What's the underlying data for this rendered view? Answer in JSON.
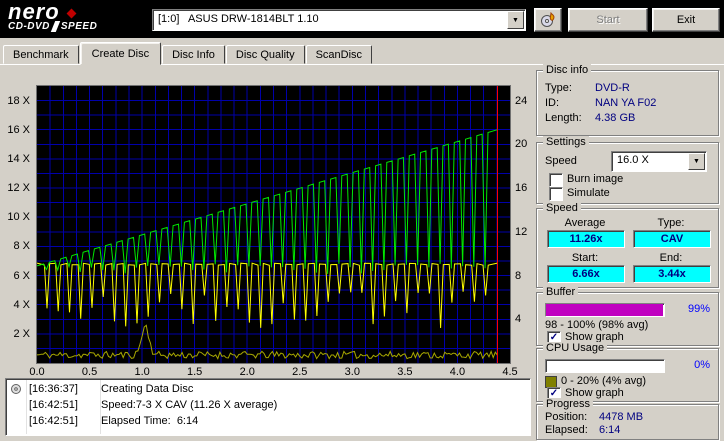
{
  "brand": {
    "name": "nero",
    "product_left": "CD-DVD",
    "product_right": "SPEED"
  },
  "icons": {
    "dropdown_arrow": "▼",
    "checkmark": "✓"
  },
  "toolbar": {
    "drive_select_value": "[1:0]   ASUS DRW-1814BLT 1.10",
    "start_label": "Start",
    "exit_label": "Exit"
  },
  "tabs": [
    {
      "label": "Benchmark",
      "active": false
    },
    {
      "label": "Create Disc",
      "active": true
    },
    {
      "label": "Disc Info",
      "active": false
    },
    {
      "label": "Disc Quality",
      "active": false
    },
    {
      "label": "ScanDisc",
      "active": false
    }
  ],
  "chart_data": {
    "type": "line",
    "title": "",
    "background": "#000000",
    "grid": {
      "color": "#0000aa",
      "x_step": 0.125,
      "y_step": 1
    },
    "x_range": [
      0,
      4.5
    ],
    "x_ticks": [
      {
        "v": 0,
        "label": "0.0"
      },
      {
        "v": 0.5,
        "label": "0.5"
      },
      {
        "v": 1,
        "label": "1.0"
      },
      {
        "v": 1.5,
        "label": "1.5"
      },
      {
        "v": 2,
        "label": "2.0"
      },
      {
        "v": 2.5,
        "label": "2.5"
      },
      {
        "v": 3,
        "label": "3.0"
      },
      {
        "v": 3.5,
        "label": "3.5"
      },
      {
        "v": 4,
        "label": "4.0"
      },
      {
        "v": 4.5,
        "label": "4.5"
      }
    ],
    "left_axis": {
      "range": [
        0,
        19
      ],
      "ticks": [
        {
          "v": 18,
          "label": "18 X"
        },
        {
          "v": 16,
          "label": "16 X"
        },
        {
          "v": 14,
          "label": "14 X"
        },
        {
          "v": 12,
          "label": "12 X"
        },
        {
          "v": 10,
          "label": "10 X"
        },
        {
          "v": 8,
          "label": "8 X"
        },
        {
          "v": 6,
          "label": "6 X"
        },
        {
          "v": 4,
          "label": "4 X"
        },
        {
          "v": 2,
          "label": "2 X"
        }
      ]
    },
    "right_axis": {
      "range": [
        0,
        25.33
      ],
      "ticks": [
        {
          "v": 24,
          "label": "24"
        },
        {
          "v": 20,
          "label": "20"
        },
        {
          "v": 16,
          "label": "16"
        },
        {
          "v": 12,
          "label": "12"
        },
        {
          "v": 8,
          "label": "8"
        },
        {
          "v": 4,
          "label": "4"
        }
      ]
    },
    "disc_end_marker": {
      "x": 4.38,
      "color": "#ff0000"
    },
    "series": [
      {
        "name": "cpu-usage",
        "color": "#a8a800",
        "shape": "noise",
        "x_end": 4.38,
        "base": 0.3,
        "amplitude": 0.5,
        "bumps": [
          {
            "x": 1.03,
            "height": 2.0,
            "width": 0.05
          }
        ]
      },
      {
        "name": "buffer-level",
        "color": "#ffff00",
        "shape": "flat-with-dips",
        "x_end": 4.38,
        "base": 6.85,
        "dip_period": 0.107,
        "dip_min": 2.3,
        "dip_max": 5.0
      },
      {
        "name": "write-speed",
        "color": "#00e800",
        "shape": "cav-with-dips",
        "x_end": 4.38,
        "y_start": 6.66,
        "y_end": 16.0,
        "dip_period": 0.107,
        "dip_min": 6.1,
        "dip_max": 6.8
      }
    ]
  },
  "panels": {
    "disc_info": {
      "title": "Disc info",
      "rows": [
        {
          "label": "Type:",
          "value": "DVD-R"
        },
        {
          "label": "ID:",
          "value": "NAN YA F02"
        },
        {
          "label": "Length:",
          "value": "4.38 GB"
        }
      ]
    },
    "settings": {
      "title": "Settings",
      "speed_label": "Speed",
      "speed_value": "16.0 X",
      "burn_image_label": "Burn image",
      "burn_image_checked": false,
      "simulate_label": "Simulate",
      "simulate_checked": false
    },
    "speed": {
      "title": "Speed",
      "average_label": "Average",
      "average_value": "11.26x",
      "type_label": "Type:",
      "type_value": "CAV",
      "start_label": "Start:",
      "start_value": "6.66x",
      "end_label": "End:",
      "end_value": "3.44x",
      "value_bg": "#00ffff"
    },
    "buffer": {
      "title": "Buffer",
      "percent_label": "99%",
      "fill_percent": 99,
      "fill_color": "#c000c0",
      "range_text": "98 - 100% (98% avg)",
      "show_graph_label": "Show graph",
      "show_graph_checked": true
    },
    "cpu": {
      "title": "CPU Usage",
      "percent_label": "0%",
      "fill_percent": 0,
      "fill_color": "#808000",
      "swatch_color": "#808000",
      "range_text": "0 - 20% (4% avg)",
      "show_graph_label": "Show graph",
      "show_graph_checked": true
    },
    "progress": {
      "title": "Progress",
      "position_label": "Position:",
      "position_value": "4478 MB",
      "elapsed_label": "Elapsed:",
      "elapsed_value": "6:14"
    }
  },
  "log": {
    "rows": [
      {
        "time": "[16:36:37]",
        "text": "Creating Data Disc"
      },
      {
        "time": "[16:42:51]",
        "text": "Speed:7-3 X CAV (11.26 X average)"
      },
      {
        "time": "[16:42:51]",
        "text": "Elapsed Time:  6:14"
      }
    ]
  }
}
